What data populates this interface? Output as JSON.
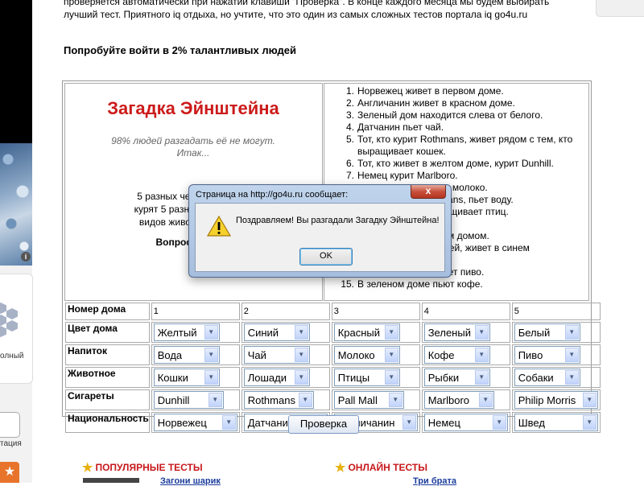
{
  "intro_text": "проверяется автоматически при нажатии клавиши \"Проверка\". В конце каждого месяца мы будем выбирать лучший тест. Приятного iq отдыха, но учтите, что это один из самых сложных тестов портала iq go4u.ru",
  "heading": "Попробуйте войти в 2% талантливых людей",
  "puzzle": {
    "title": "Загадка Эйнштейна",
    "subtitle_line1": "98% людей разгадать её не могут.",
    "subtitle_line2": "Итак...",
    "desc_line1": "5 разных человек в 5 раз",
    "desc_line2": "курят 5 разных марок сига",
    "desc_line3": "видов животных, пьют 5",
    "question": "Вопрос: Кто вы"
  },
  "clues": [
    {
      "n": "1.",
      "t": "Норвежец живет в первом доме."
    },
    {
      "n": "2.",
      "t": "Англичанин живет в красном доме."
    },
    {
      "n": "3.",
      "t": "Зеленый дом находится слева от белого."
    },
    {
      "n": "4.",
      "t": "Датчанин пьет чай."
    },
    {
      "n": "5.",
      "t": "Тот, кто курит Rothmans, живет рядом с тем, кто выращивает кошек."
    },
    {
      "n": "6.",
      "t": "Тот, кто живет в желтом доме, курит Dunhill."
    },
    {
      "n": "7.",
      "t": "Немец курит Marlboro."
    },
    {
      "n": "",
      "t": "                       е, пьет молоко."
    },
    {
      "n": "",
      "t": "                       Rothmans, пьет воду."
    },
    {
      "n": "",
      "t": "                       l, выращивает птиц."
    },
    {
      "n": "",
      "t": "                       бак."
    },
    {
      "n": "",
      "t": "                       с синим домом."
    },
    {
      "n": "",
      "t": "                       лошадей, живет в синем"
    },
    {
      "n": "",
      "t": ""
    },
    {
      "n": "",
      "t": "                       rris, пьет пиво."
    },
    {
      "n": "15.",
      "t": "В зеленом доме пьют кофе."
    }
  ],
  "grid": {
    "num_label": "Номер дома",
    "numbers": [
      "1",
      "2",
      "3",
      "4",
      "5"
    ],
    "rows": [
      {
        "label": "Цвет дома",
        "values": [
          "Желтый",
          "Синий",
          "Красный",
          "Зеленый",
          "Белый"
        ]
      },
      {
        "label": "Напиток",
        "values": [
          "Вода",
          "Чай",
          "Молоко",
          "Кофе",
          "Пиво"
        ]
      },
      {
        "label": "Животное",
        "values": [
          "Кошки",
          "Лошади",
          "Птицы",
          "Рыбки",
          "Собаки"
        ]
      },
      {
        "label": "Сигареты",
        "values": [
          "Dunhill",
          "Rothmans",
          "Pall Mall",
          "Marlboro",
          "Philip Morris"
        ]
      },
      {
        "label": "Национальность",
        "values": [
          "Норвежец",
          "Датчанин",
          "Англичанин",
          "Немец",
          "Швед"
        ]
      }
    ]
  },
  "check_button": "Проверка",
  "popular": {
    "title": "ПОПУЛЯРНЫЕ ТЕСТЫ",
    "first_link": "Загони шарик"
  },
  "online": {
    "title": "ОНЛАЙН ТЕСТЫ",
    "first_link": "Три брата"
  },
  "left": {
    "label1": "олный",
    "label2": "тация"
  },
  "dialog": {
    "title": "Страница на http://go4u.ru сообщает:",
    "close": "x",
    "message": "Поздравляем! Вы разгадали Загадку Эйнштейна!",
    "ok": "OK"
  }
}
